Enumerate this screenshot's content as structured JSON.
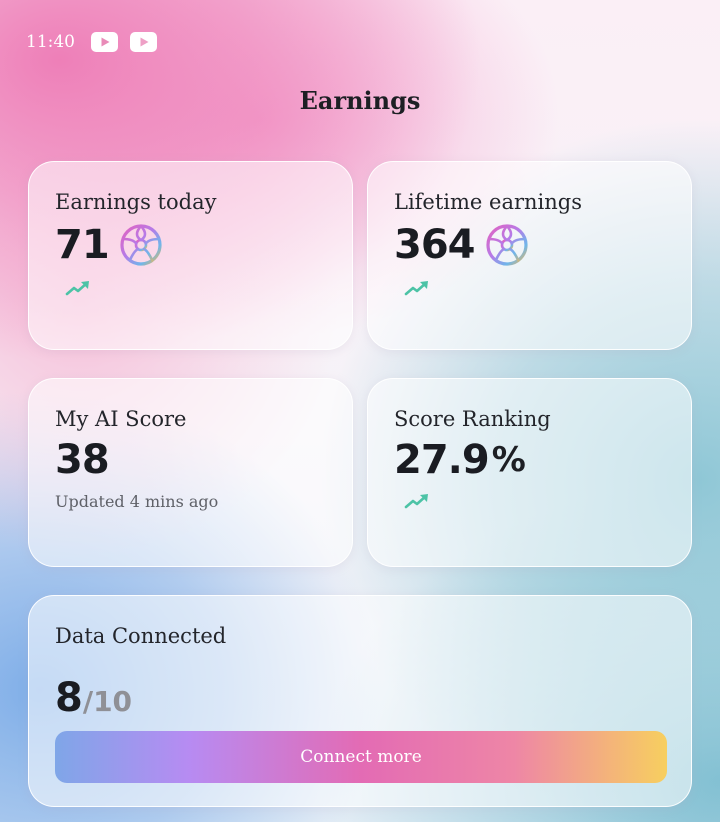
{
  "status_bar": {
    "time": "11:40",
    "icons": [
      "youtube-icon",
      "youtube-icon"
    ]
  },
  "header": {
    "title": "Earnings"
  },
  "cards": {
    "earnings_today": {
      "label": "Earnings today",
      "value": "71",
      "icon": "coin-icon",
      "trend": "trend-up-icon"
    },
    "lifetime_earnings": {
      "label": "Lifetime earnings",
      "value": "364",
      "icon": "coin-icon",
      "trend": "trend-up-icon"
    },
    "ai_score": {
      "label": "My AI Score",
      "value": "38",
      "updated": "Updated 4 mins ago"
    },
    "score_ranking": {
      "label": "Score Ranking",
      "value": "27.9",
      "unit": "%",
      "trend": "trend-up-icon"
    },
    "data_connected": {
      "label": "Data Connected",
      "connected": "8",
      "total": "/10",
      "button_label": "Connect more"
    }
  },
  "colors": {
    "trend": "#4cc3a6",
    "button_gradient": [
      "#7fa6e8",
      "#b78bf2",
      "#e36bb4",
      "#ee86a6",
      "#f7cf5f"
    ]
  }
}
